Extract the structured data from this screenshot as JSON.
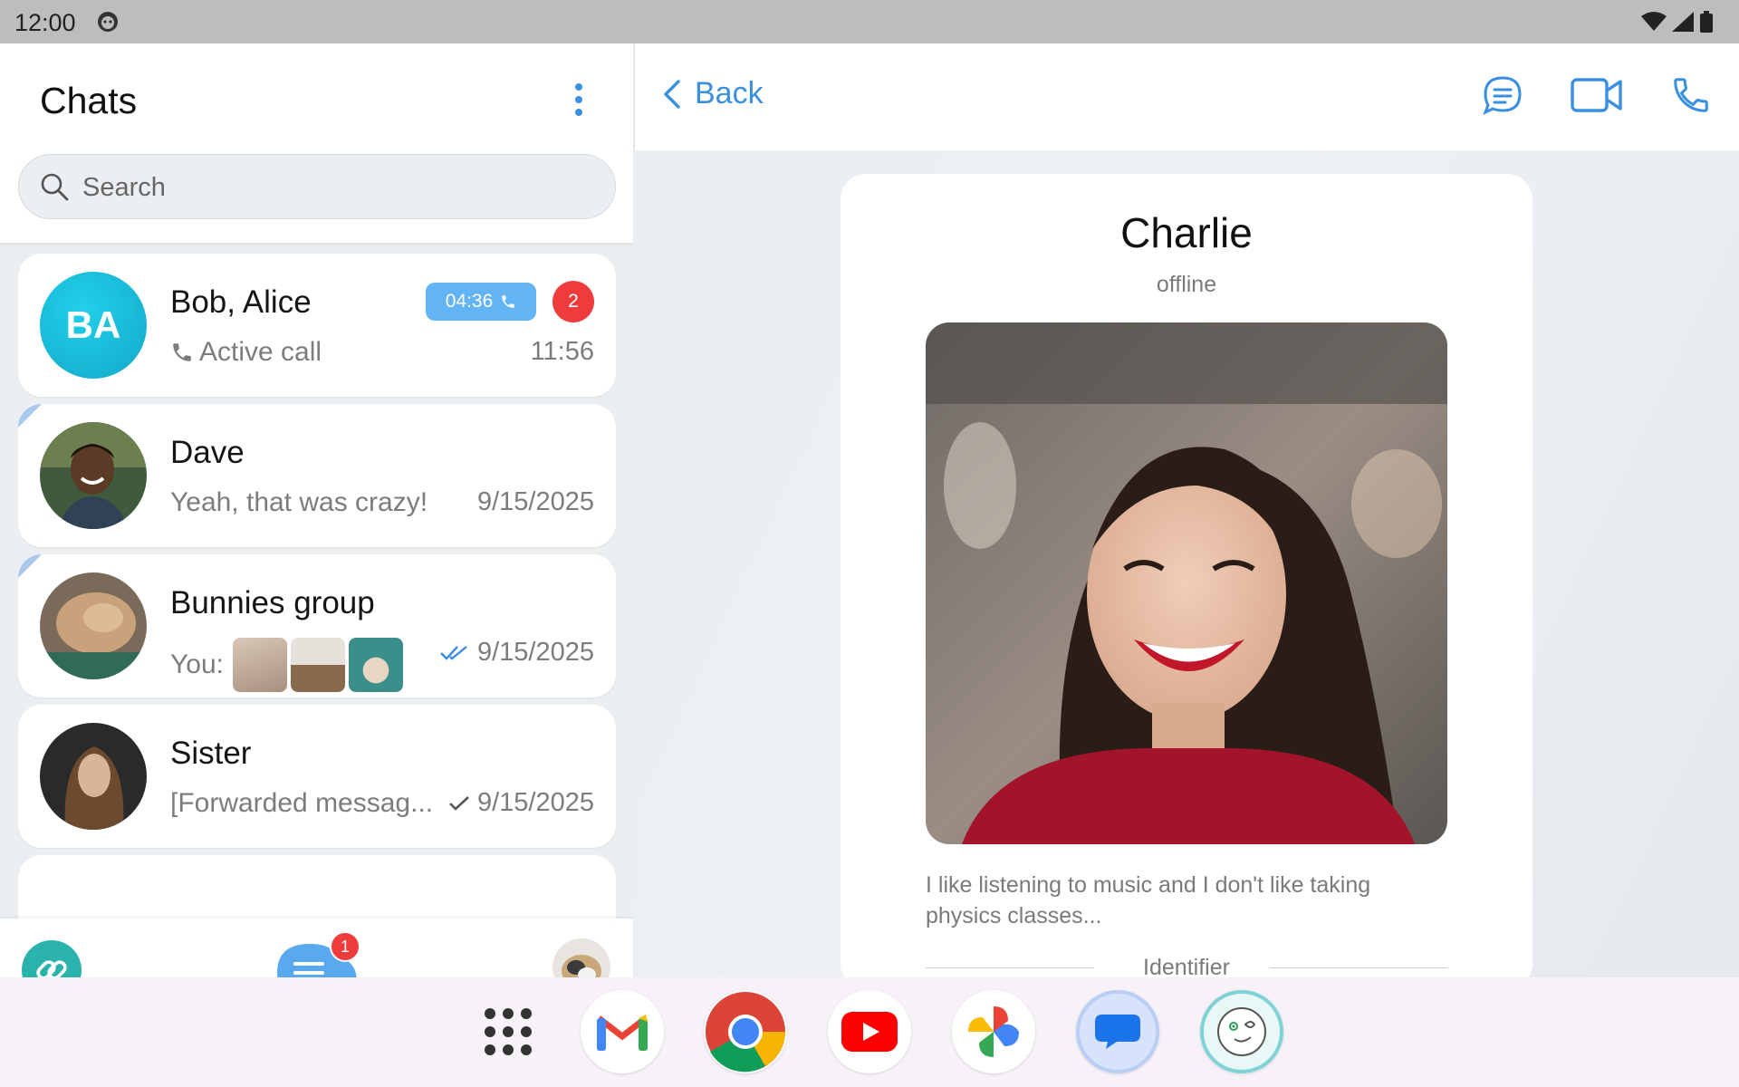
{
  "status_bar": {
    "time": "12:00"
  },
  "chats_panel": {
    "title": "Chats",
    "search_placeholder": "Search",
    "chats": [
      {
        "name": "Bob, Alice",
        "initials": "BA",
        "preview": "Active call",
        "time": "11:56",
        "call_duration": "04:36",
        "unread": "2"
      },
      {
        "name": "Dave",
        "preview": "Yeah, that was crazy!",
        "time": "9/15/2025"
      },
      {
        "name": "Bunnies group",
        "preview": "You:",
        "time": "9/15/2025"
      },
      {
        "name": "Sister",
        "preview": "[Forwarded messag...",
        "time": "9/15/2025"
      }
    ],
    "nav_badge": "1"
  },
  "profile_panel": {
    "back_label": "Back",
    "name": "Charlie",
    "status": "offline",
    "bio": "I like listening to music and I don't like taking physics classes...",
    "identifier_label": "Identifier"
  },
  "colors": {
    "accent": "#3a8fe0",
    "call_pill": "#62b4f4",
    "badge": "#ee3c3c",
    "avatar_teal": "#12a9c9"
  },
  "dock_apps": [
    "app-drawer-icon",
    "gmail-icon",
    "chrome-icon",
    "youtube-icon",
    "photos-icon",
    "messages-icon",
    "messenger-app-icon"
  ]
}
